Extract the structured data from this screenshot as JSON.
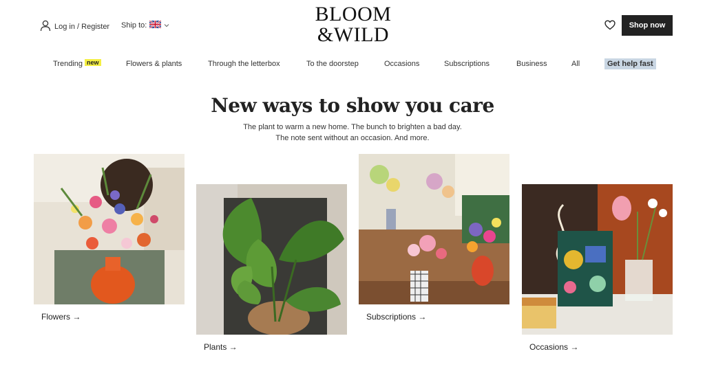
{
  "header": {
    "account_label": "Log in / Register",
    "ship_label": "Ship to:",
    "logo_line1": "BLOOM",
    "logo_line2": "&WILD",
    "shop_now": "Shop now",
    "icons": [
      "user-icon",
      "uk-flag-icon",
      "chevron-down-icon",
      "heart-icon"
    ]
  },
  "nav": {
    "items": [
      "Trending",
      "Flowers & plants",
      "Through the letterbox",
      "To the doorstep",
      "Occasions",
      "Subscriptions",
      "Business",
      "All",
      "Get help fast"
    ],
    "new_badge": "new"
  },
  "hero": {
    "title": "New ways to show you care",
    "subtitle_line1": "The plant to warm a new home. The bunch to brighten a bad day.",
    "subtitle_line2": "The note sent without an occasion. And more."
  },
  "cards": [
    {
      "label": "Flowers →"
    },
    {
      "label": "Plants →"
    },
    {
      "label": "Subscriptions →"
    },
    {
      "label": "Occasions →"
    }
  ],
  "colors": {
    "accent_dark": "#222222",
    "new_badge": "#f4ef43",
    "help_bg": "#c9d6e3"
  }
}
